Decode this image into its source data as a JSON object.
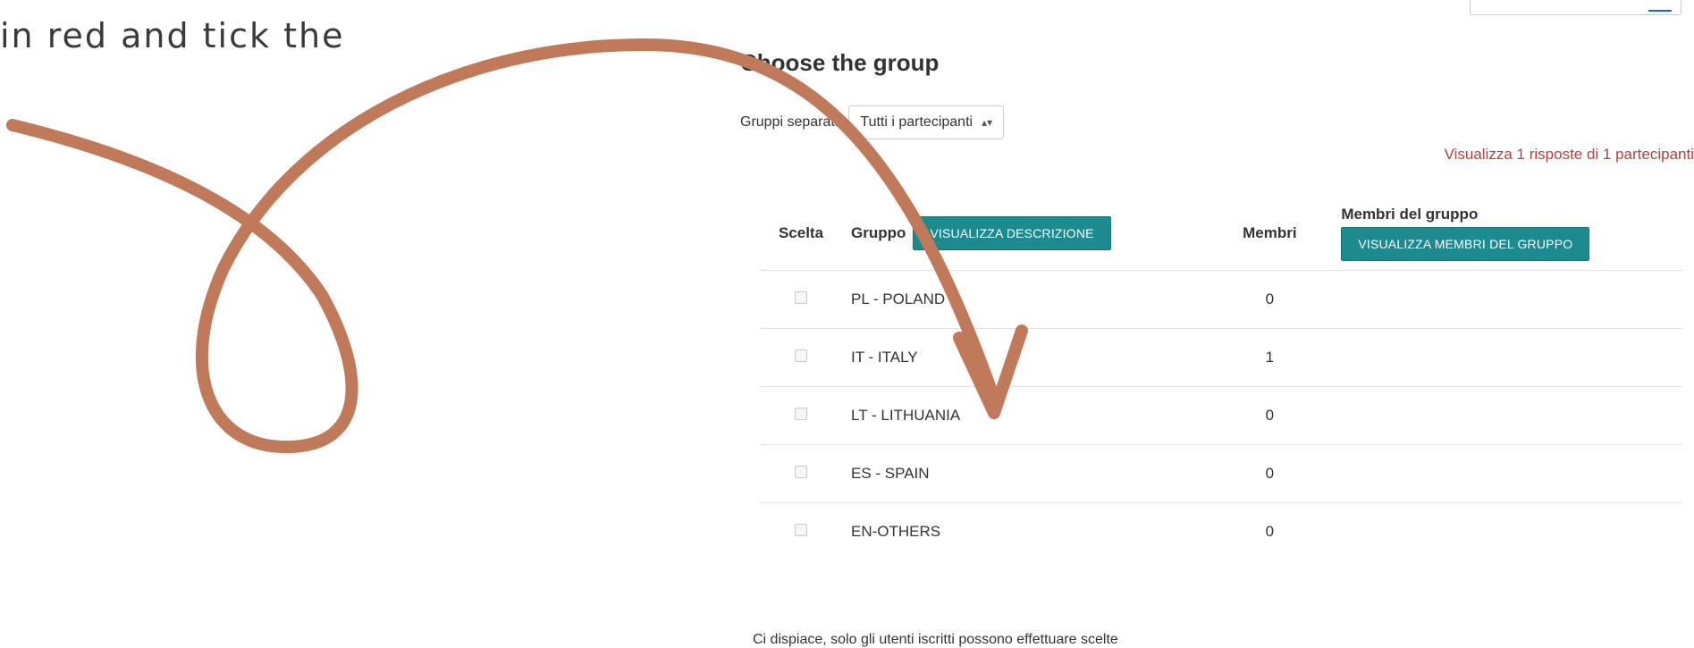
{
  "instruction": {
    "line2": "in red and tick the"
  },
  "header": {
    "title": "Choose the group"
  },
  "group_filter": {
    "label": "Gruppi separati",
    "selected": "Tutti i partecipanti"
  },
  "summary_link": "Visualizza 1 risposte di 1 partecipanti",
  "table": {
    "headers": {
      "scelta": "Scelta",
      "gruppo": "Gruppo",
      "descrizione_button": "VISUALIZZA DESCRIZIONE",
      "membri": "Membri",
      "membri_gruppo": "Membri del gruppo",
      "membri_gruppo_button": "VISUALIZZA MEMBRI DEL GRUPPO"
    },
    "rows": [
      {
        "group": "PL - POLAND",
        "members": "0"
      },
      {
        "group": "IT - ITALY",
        "members": "1"
      },
      {
        "group": "LT - LITHUANIA",
        "members": "0"
      },
      {
        "group": "ES - SPAIN",
        "members": "0"
      },
      {
        "group": "EN-OTHERS",
        "members": "0"
      }
    ]
  },
  "footer_note": "Ci dispiace, solo gli utenti iscritti possono effettuare scelte",
  "colors": {
    "accent_button": "#1d8a8f",
    "link_red": "#b0413e",
    "arrow": "#c07a5a"
  }
}
